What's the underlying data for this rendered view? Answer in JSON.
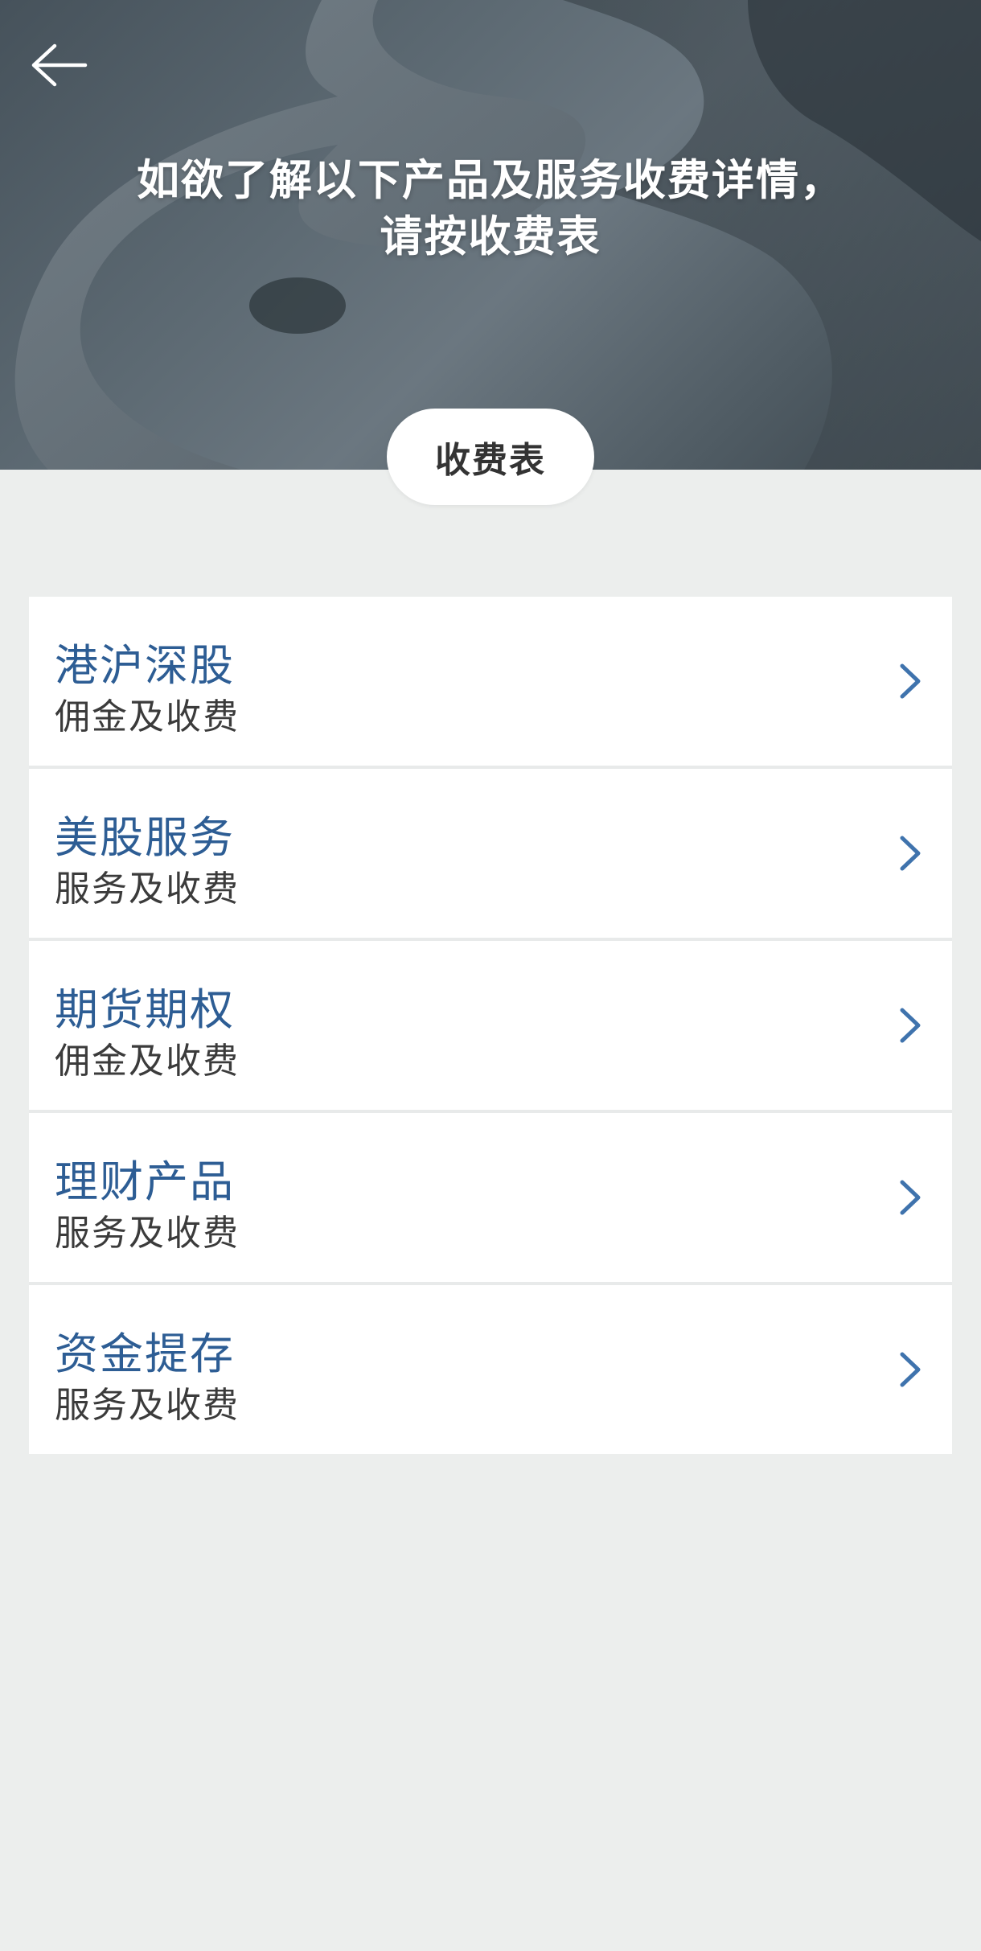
{
  "header": {
    "back_icon": "arrow-left-icon",
    "title": "如欲了解以下产品及服务收费详情，请按收费表",
    "fee_button_label": "收费表"
  },
  "list": {
    "items": [
      {
        "title": "港沪深股",
        "subtitle": "佣金及收费",
        "icon": "chevron-right-icon"
      },
      {
        "title": "美股服务",
        "subtitle": "服务及收费",
        "icon": "chevron-right-icon"
      },
      {
        "title": "期货期权",
        "subtitle": "佣金及收费",
        "icon": "chevron-right-icon"
      },
      {
        "title": "理财产品",
        "subtitle": "服务及收费",
        "icon": "chevron-right-icon"
      },
      {
        "title": "资金提存",
        "subtitle": "服务及收费",
        "icon": "chevron-right-icon"
      }
    ]
  },
  "colors": {
    "accent": "#2d5d94",
    "chevron": "#3f73ad",
    "page_background": "#eceeed",
    "card_background": "#ffffff",
    "subtitle_text": "#3b3b3b"
  }
}
